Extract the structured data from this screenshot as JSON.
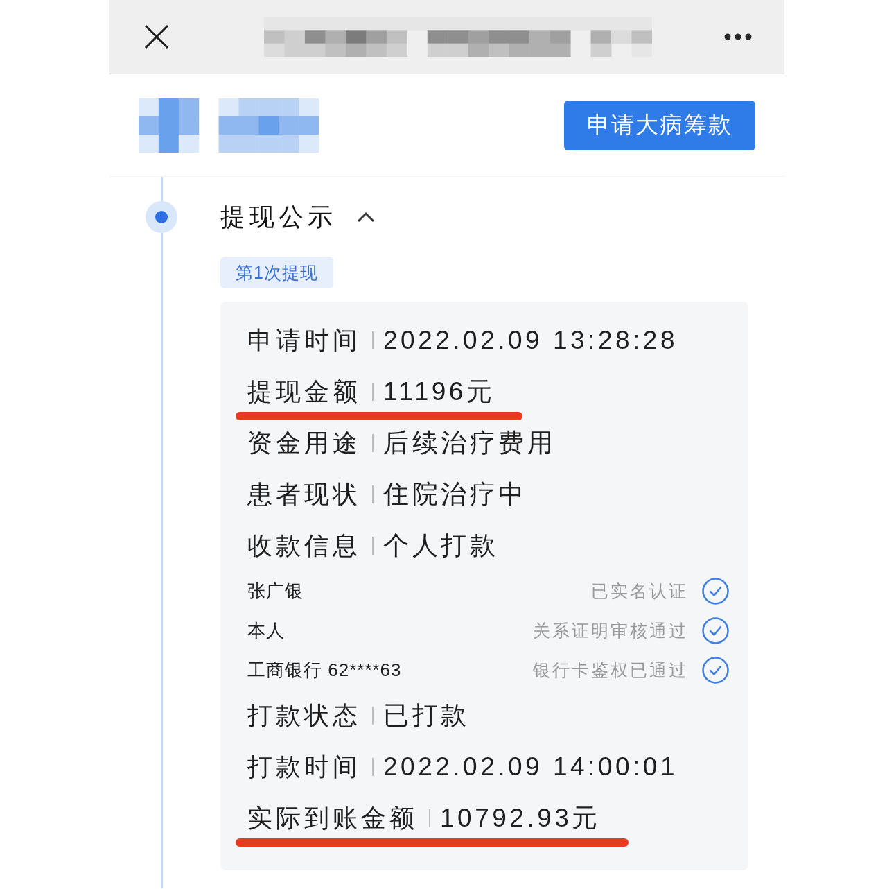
{
  "header": {
    "button": "申请大病筹款"
  },
  "section": {
    "title": "提现公示",
    "expanded": true,
    "tag": "第1次提现",
    "rows": [
      {
        "kind": "field",
        "label": "申请时间",
        "value": "2022.02.09 13:28:28",
        "underlined": false
      },
      {
        "kind": "field",
        "label": "提现金额",
        "value": "11196元",
        "underlined": true
      },
      {
        "kind": "field",
        "label": "资金用途",
        "value": "后续治疗费用",
        "underlined": false
      },
      {
        "kind": "field",
        "label": "患者现状",
        "value": "住院治疗中",
        "underlined": false
      },
      {
        "kind": "field",
        "label": "收款信息",
        "value": "个人打款",
        "underlined": false
      },
      {
        "kind": "detail",
        "text": "张广银",
        "status": "已实名认证"
      },
      {
        "kind": "detail",
        "text": "本人",
        "status": "关系证明审核通过"
      },
      {
        "kind": "detail",
        "text": "工商银行 62****63",
        "status": "银行卡鉴权已通过"
      },
      {
        "kind": "field",
        "label": "打款状态",
        "value": "已打款",
        "underlined": false
      },
      {
        "kind": "field",
        "label": "打款时间",
        "value": "2022.02.09 14:00:01",
        "underlined": false
      },
      {
        "kind": "field",
        "label": "实际到账金额",
        "value": "10792.93元",
        "underlined": true
      }
    ]
  }
}
